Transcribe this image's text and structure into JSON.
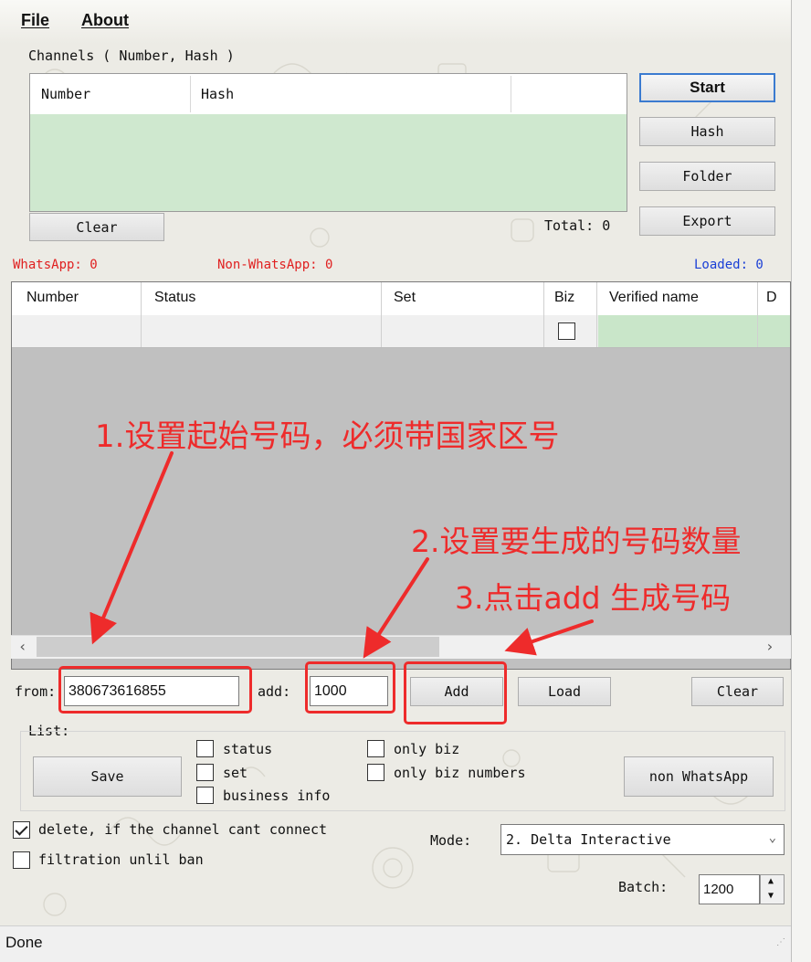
{
  "menu": {
    "file": "File",
    "about": "About"
  },
  "channels": {
    "group_label": "Channels ( Number, Hash )",
    "columns": [
      "Number",
      "Hash"
    ],
    "clear_button": "Clear",
    "total_label": "Total: 0"
  },
  "side_buttons": {
    "start": "Start",
    "hash": "Hash",
    "folder": "Folder",
    "export": "Export"
  },
  "counters": {
    "whatsapp": "WhatsApp: 0",
    "non_whatsapp": "Non-WhatsApp: 0",
    "loaded": "Loaded: 0"
  },
  "grid": {
    "columns": [
      "Number",
      "Status",
      "Set",
      "Biz",
      "Verified name",
      "D"
    ]
  },
  "generator": {
    "from_label": "from:",
    "from_value": "380673616855",
    "add_label": "add:",
    "add_value": "1000",
    "add_button": "Add",
    "load_button": "Load",
    "clear_button": "Clear"
  },
  "list_section": {
    "label": "List:",
    "save_button": "Save",
    "options": {
      "status": "status",
      "set": "set",
      "business_info": "business info",
      "only_biz": "only biz",
      "only_biz_numbers": "only biz numbers"
    },
    "non_whatsapp_button": "non WhatsApp"
  },
  "options": {
    "delete_if_cant_connect": {
      "label": "delete, if the channel cant connect",
      "checked": true
    },
    "filtration_until_ban": {
      "label": "filtration unlil ban",
      "checked": false
    }
  },
  "mode": {
    "label": "Mode:",
    "selected": "2. Delta Interactive"
  },
  "batch": {
    "label": "Batch:",
    "value": "1200"
  },
  "status_bar": {
    "text": "Done"
  },
  "annotations": {
    "step1": "1.设置起始号码，必须带国家区号",
    "step2": "2.设置要生成的号码数量",
    "step3": "3.点击add 生成号码"
  },
  "colors": {
    "annotation": "#ee2b2b",
    "whatsapp_counter": "#e02020",
    "loaded_counter": "#1a3fd6",
    "channel_list_bg": "#cfe8cf",
    "grid_bg": "#c0c0c0"
  }
}
